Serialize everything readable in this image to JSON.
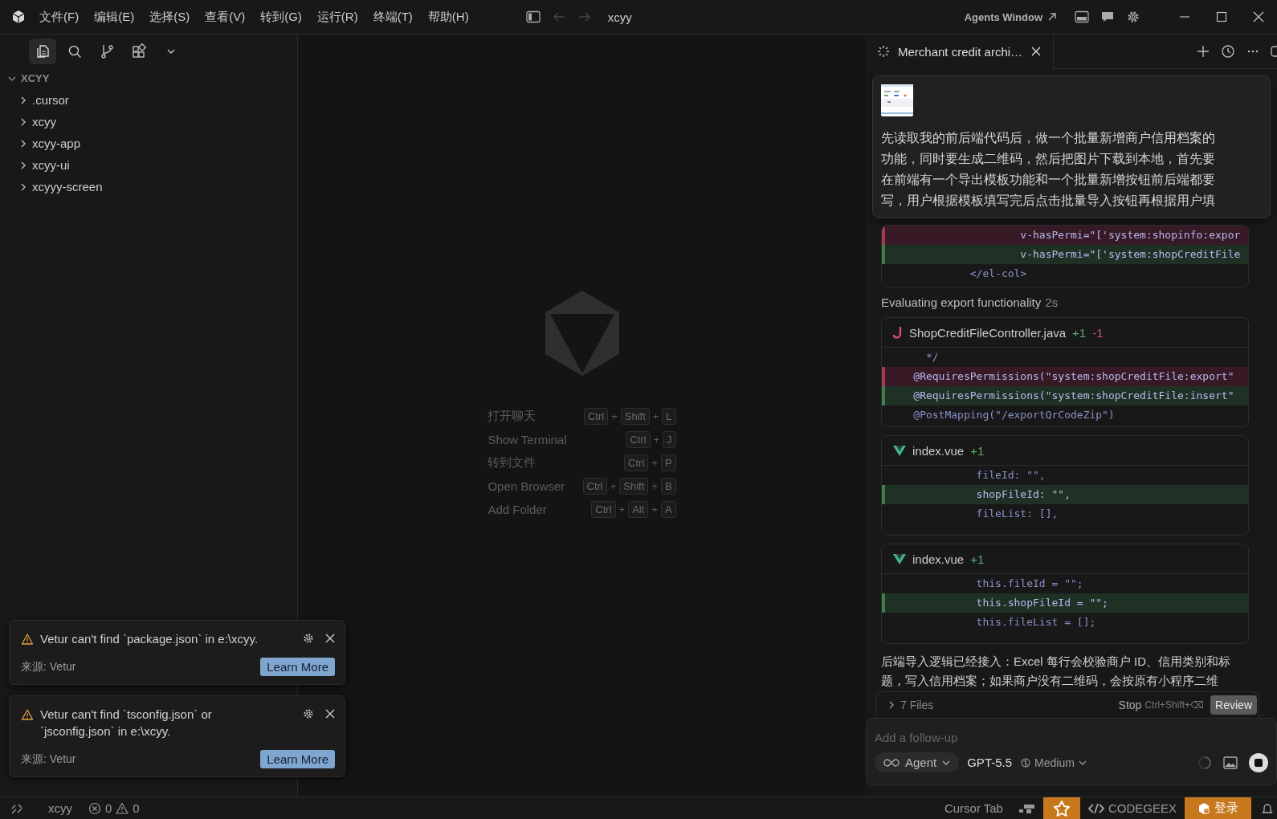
{
  "title_bar": {
    "menus": [
      "文件(F)",
      "编辑(E)",
      "选择(S)",
      "查看(V)",
      "转到(G)",
      "运行(R)",
      "终端(T)",
      "帮助(H)"
    ],
    "back": {
      "disabled": true
    },
    "forward": {
      "disabled": true
    },
    "title": "xcyy",
    "agents_window": "Agents Window"
  },
  "sidebar": {
    "tools": [
      {
        "kind": "files",
        "selected": true
      },
      {
        "kind": "search",
        "selected": false
      },
      {
        "kind": "source-control",
        "selected": false
      },
      {
        "kind": "extensions",
        "selected": false
      },
      {
        "kind": "more",
        "selected": false
      }
    ],
    "tree": {
      "label": "XCYY",
      "expanded": true,
      "children": [
        {
          "label": ".cursor",
          "expanded": false
        },
        {
          "label": "xcyy",
          "expanded": false
        },
        {
          "label": "xcyy-app",
          "expanded": false
        },
        {
          "label": "xcyy-ui",
          "expanded": false
        },
        {
          "label": "xcyyy-screen",
          "expanded": false
        }
      ]
    }
  },
  "center": {
    "shortcuts": [
      {
        "label": "打开聊天",
        "keys": [
          "Ctrl",
          "Shift",
          "L"
        ],
        "separator": "+"
      },
      {
        "label": "Show Terminal",
        "keys": [
          "Ctrl",
          "J"
        ],
        "separator": "+"
      },
      {
        "label": "转到文件",
        "keys": [
          "Ctrl",
          "P"
        ],
        "separator": "+"
      },
      {
        "label": "Open Browser",
        "keys": [
          "Ctrl",
          "Shift",
          "B"
        ],
        "separator": "+"
      },
      {
        "label": "Add Folder",
        "keys": [
          "Ctrl",
          "Alt",
          "A"
        ],
        "separator": "+"
      }
    ]
  },
  "chat": {
    "tab": {
      "title": "Merchant credit archi…",
      "loading": true
    },
    "message": {
      "text": "先读取我的前后端代码后，做一个批量新增商户信用档案的功能，同时要生成二维码，然后把图片下载到本地，首先要在前端有一个导出模板功能和一个批量新增按钮前后端都要写，用户根据模板填写完后点击批量导入按钮再根据用户填"
    },
    "items": [
      {
        "kind": "diff",
        "lines": [
          {
            "added": false,
            "removed": true,
            "code": "                     v-hasPermi=\"['system:shopinfo:expor"
          },
          {
            "added": true,
            "removed": false,
            "code": "                     v-hasPermi=\"['system:shopCreditFile"
          },
          {
            "added": false,
            "removed": false,
            "code": "             </el-col>"
          }
        ]
      },
      {
        "kind": "status",
        "text": "Evaluating export functionality",
        "time": "2s"
      },
      {
        "kind": "diff",
        "file": {
          "kind": "java",
          "name": "ShopCreditFileController.java"
        },
        "added": "+1",
        "removed": "-1",
        "lines": [
          {
            "added": false,
            "removed": false,
            "code": "      */"
          },
          {
            "added": false,
            "removed": true,
            "code": "    @RequiresPermissions(\"system:shopCreditFile:export\""
          },
          {
            "added": true,
            "removed": false,
            "code": "    @RequiresPermissions(\"system:shopCreditFile:insert\""
          },
          {
            "added": false,
            "removed": false,
            "code": "    @PostMapping(\"/exportQrCodeZip\")"
          }
        ]
      },
      {
        "kind": "diff",
        "file": {
          "kind": "vue",
          "name": "index.vue"
        },
        "added": "+1",
        "lines": [
          {
            "added": false,
            "removed": false,
            "code": "              fileId: \"\","
          },
          {
            "added": true,
            "removed": false,
            "code": "              shopFileId: \"\","
          },
          {
            "added": false,
            "removed": false,
            "code": "              fileList: [],"
          }
        ]
      },
      {
        "kind": "diff",
        "file": {
          "kind": "vue",
          "name": "index.vue"
        },
        "added": "+1",
        "lines": [
          {
            "added": false,
            "removed": false,
            "code": "              this.fileId = \"\";"
          },
          {
            "added": true,
            "removed": false,
            "code": "              this.shopFileId = \"\";"
          },
          {
            "added": false,
            "removed": false,
            "code": "              this.fileList = [];"
          }
        ]
      },
      {
        "kind": "text",
        "text": "后端导入逻辑已经接入：Excel 每行会校验商户 ID、信用类别和标题，写入信用档案；如果商户没有二维码，会按原有小程序二维"
      }
    ],
    "files_bar": {
      "label": "7 Files",
      "expanded": false,
      "stop": "Stop",
      "stop_shortcut": "Ctrl+Shift+⌫",
      "review": "Review"
    },
    "composer": {
      "placeholder": "Add a follow-up",
      "mode": "Agent",
      "model": "GPT-5.5",
      "effort": "Medium",
      "running": true
    }
  },
  "notifications": [
    {
      "message": "Vetur can't find `package.json` in e:\\xcyy.",
      "source": "来源: Vetur",
      "action": "Learn More"
    },
    {
      "message": "Vetur can't find `tsconfig.json` or `jsconfig.json` in e:\\xcyy.",
      "source": "来源: Vetur",
      "action": "Learn More"
    }
  ],
  "status_bar": {
    "workspace": "xcyy",
    "errors": "0",
    "warnings": "0",
    "cursor_tab": "Cursor Tab",
    "codegeex": "CODEGEEX",
    "login": "登录"
  }
}
